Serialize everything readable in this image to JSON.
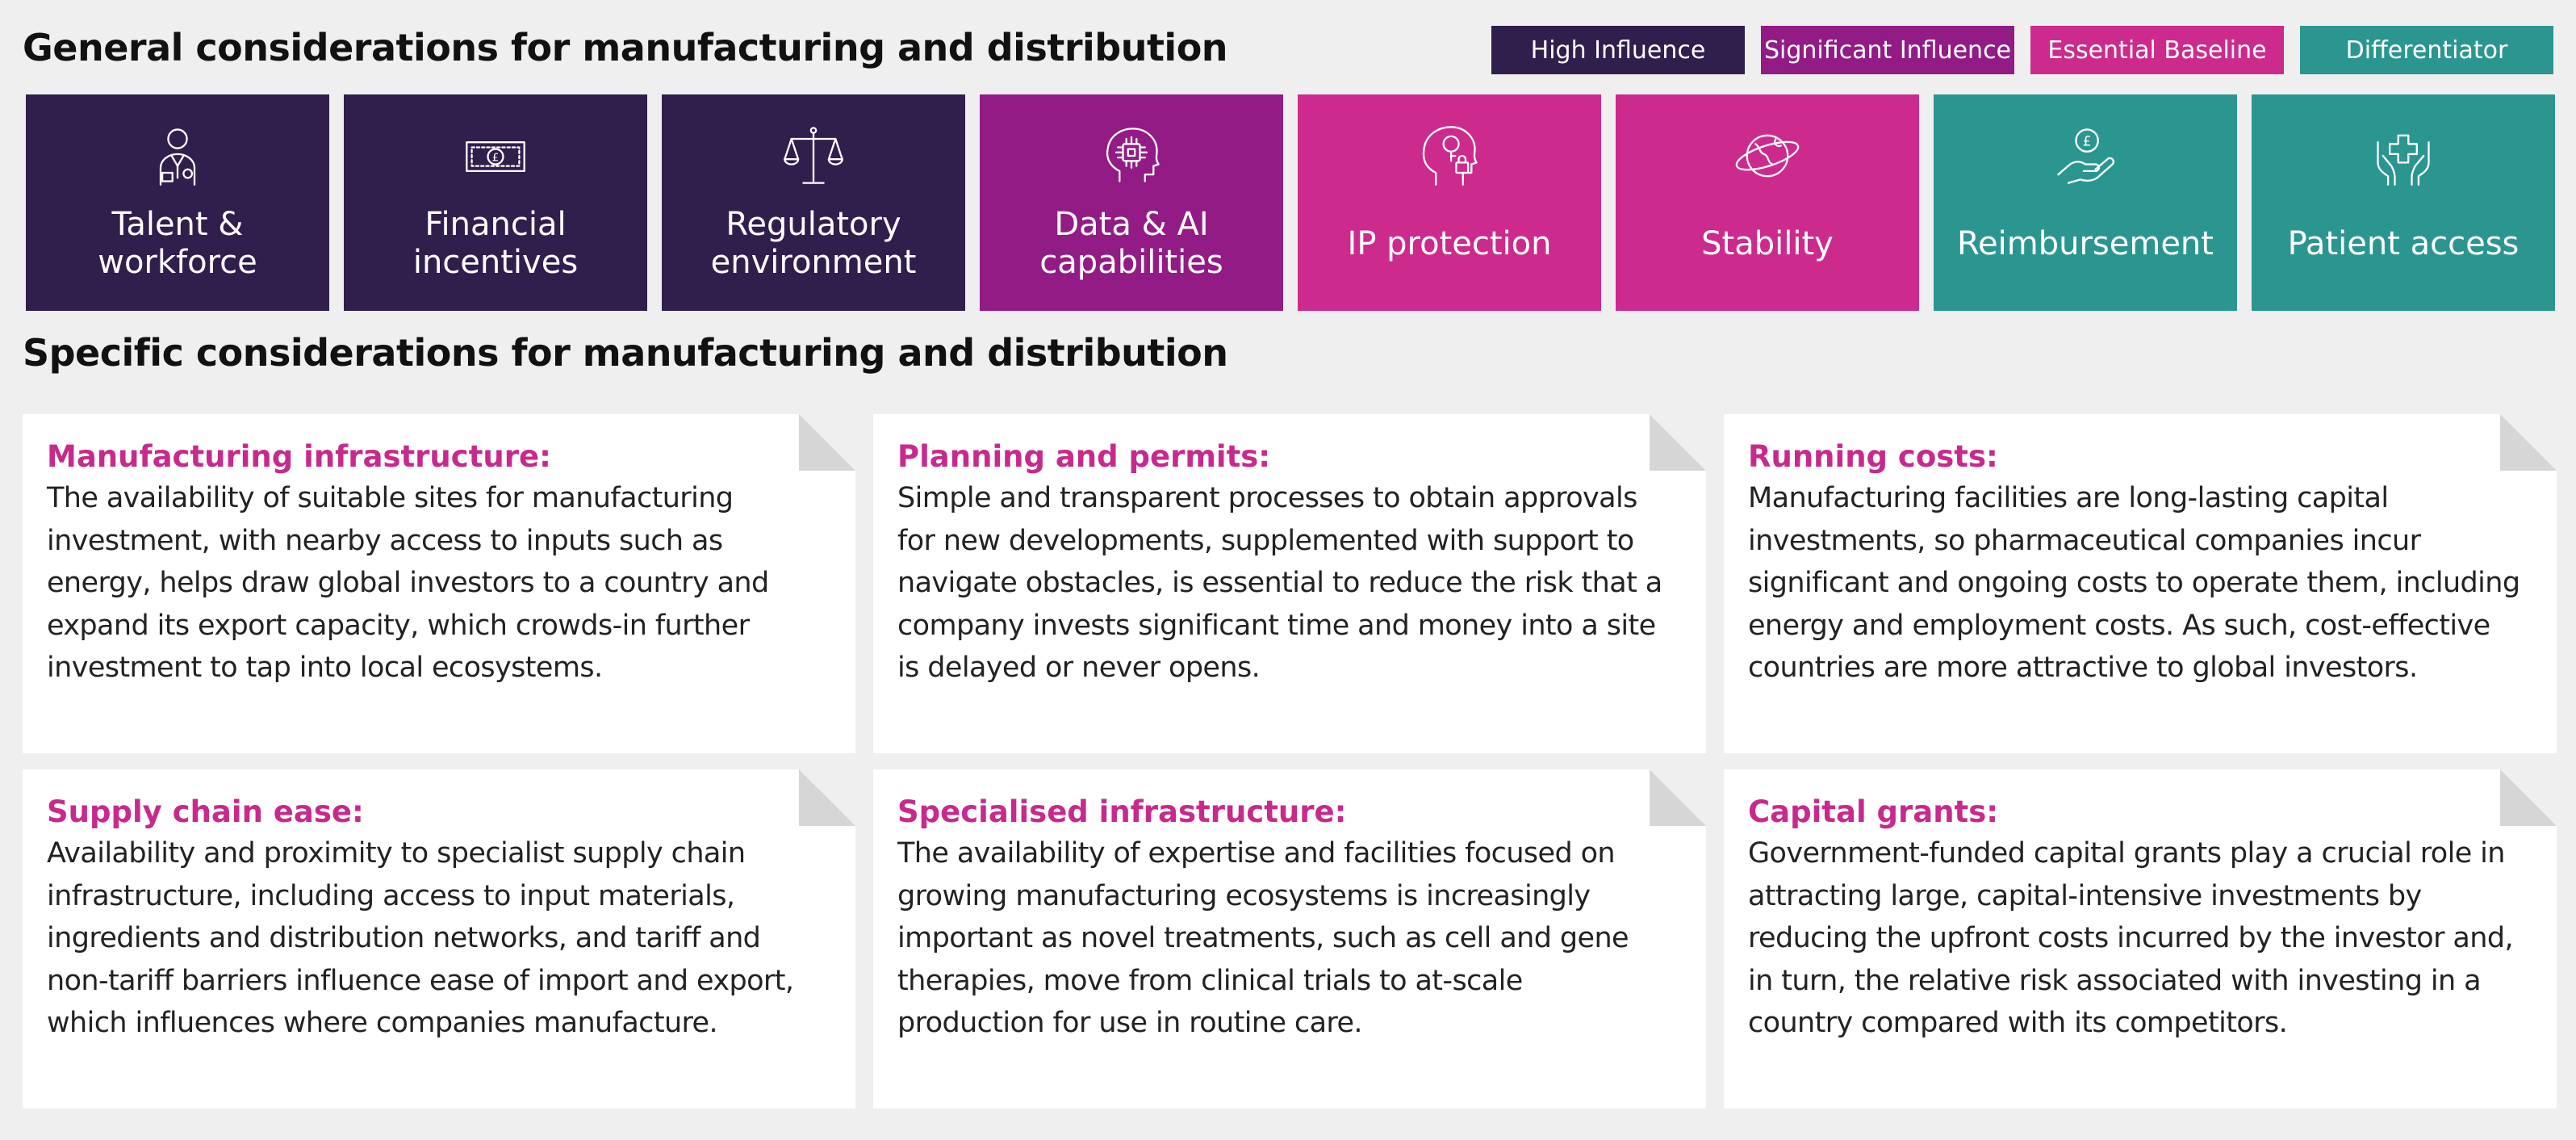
{
  "general_heading": "General considerations for manufacturing and distribution",
  "specific_heading": "Specific considerations for manufacturing and distribution",
  "colors": {
    "high_influence": "#301e4d",
    "significant_influence": "#921b86",
    "essential_baseline": "#cc2a8c",
    "differentiator": "#2b9690",
    "card_title": "#c72a8c",
    "background": "#efefef"
  },
  "legend": [
    {
      "label": "High Influence",
      "color": "#301e4d"
    },
    {
      "label": "Significant Influence",
      "color": "#921b86"
    },
    {
      "label": "Essential Baseline",
      "color": "#cc2a8c"
    },
    {
      "label": "Differentiator",
      "color": "#2b9690"
    }
  ],
  "tiles": [
    {
      "label": "Talent & workforce",
      "icon": "worker-icon",
      "color": "#301e4d"
    },
    {
      "label": "Financial incentives",
      "icon": "banknote-icon",
      "color": "#301e4d"
    },
    {
      "label": "Regulatory environment",
      "icon": "scales-icon",
      "color": "#301e4d"
    },
    {
      "label": "Data & AI capabilities",
      "icon": "ai-brain-icon",
      "color": "#921b86"
    },
    {
      "label": "IP protection",
      "icon": "lock-head-icon",
      "color": "#cc2a8c"
    },
    {
      "label": "Stability",
      "icon": "globe-icon",
      "color": "#cc2a8c"
    },
    {
      "label": "Reimbursement",
      "icon": "coin-hand-icon",
      "color": "#2b9690"
    },
    {
      "label": "Patient access",
      "icon": "healthcare-hands-icon",
      "color": "#2b9690"
    }
  ],
  "cards": [
    {
      "title": "Manufacturing infrastructure:",
      "body": "The availability of suitable sites for manufacturing investment, with nearby access to inputs such as energy, helps draw global investors to a country and expand its export capacity, which crowds-in further investment to tap into local ecosystems."
    },
    {
      "title": "Planning and permits:",
      "body": "Simple and transparent processes to obtain approvals for new developments, supplemented with support to navigate obstacles, is essential to reduce the risk that a company invests significant time and money into a site is delayed or never opens."
    },
    {
      "title": "Running costs:",
      "body": "Manufacturing facilities are long-lasting capital investments, so pharmaceutical companies incur significant and ongoing costs to operate them, including energy and employment costs. As such, cost-effective countries are more attractive to global investors."
    },
    {
      "title": "Supply chain ease:",
      "body": "Availability and proximity to specialist supply chain infrastructure, including access to input materials, ingredients and distribution networks, and tariff and non-tariff barriers influence ease of import and export, which influences where companies manufacture."
    },
    {
      "title": "Specialised infrastructure:",
      "body": "The availability of expertise and facilities focused on growing manufacturing ecosystems is increasingly important as novel treatments, such as cell and gene therapies, move from clinical trials to at-scale production for use in routine care."
    },
    {
      "title": "Capital grants:",
      "body": "Government-funded capital grants play a crucial role in attracting large, capital-intensive investments by reducing the upfront costs incurred by the investor and, in turn, the relative risk associated with investing in a country compared with its competitors."
    }
  ]
}
